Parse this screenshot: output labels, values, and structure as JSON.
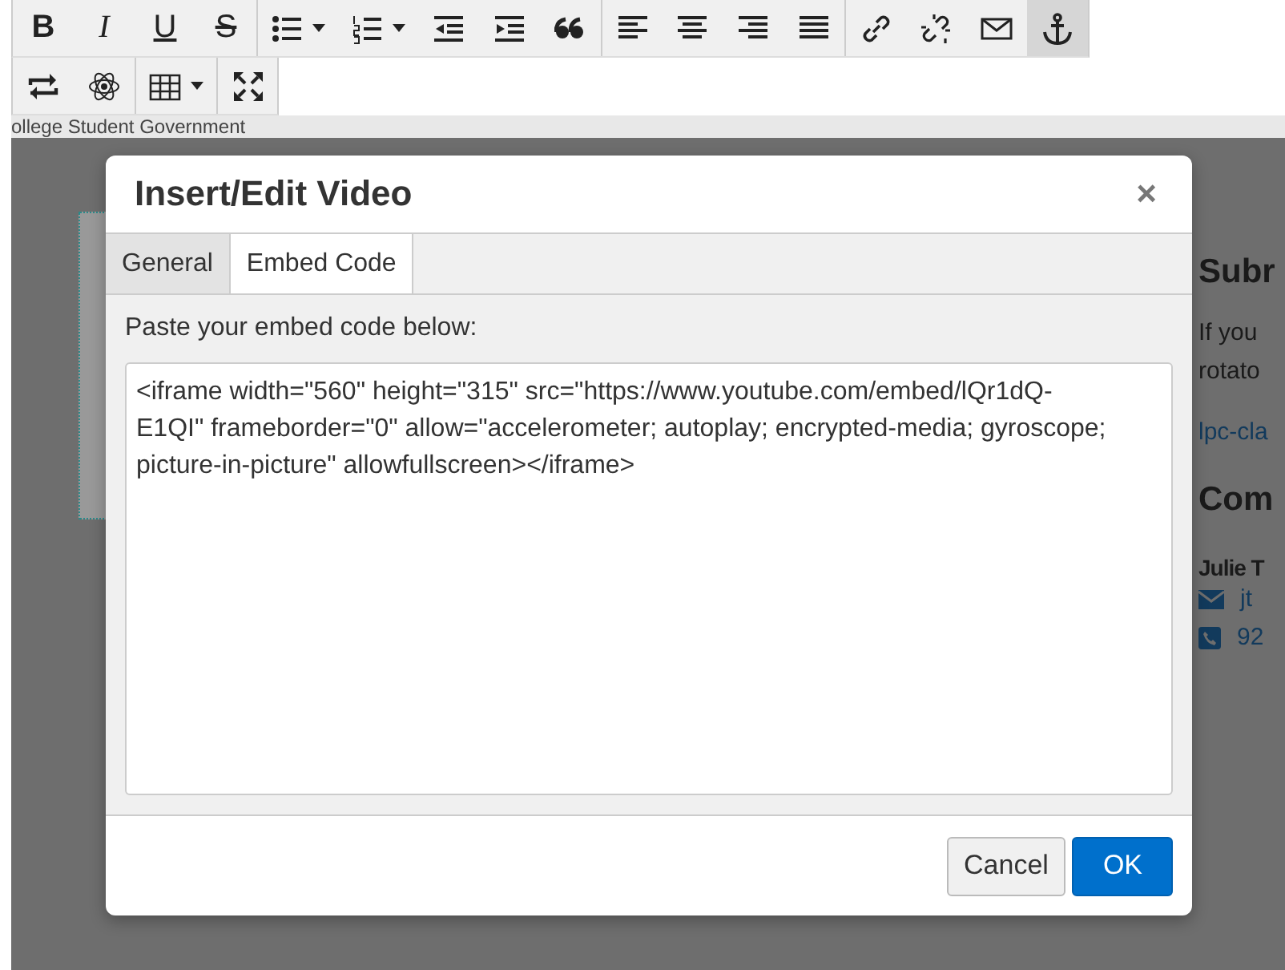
{
  "toolbar": {
    "rows": [
      [
        {
          "kind": "letter",
          "label": "B",
          "active": false
        },
        {
          "kind": "letter",
          "label": "I",
          "active": false
        },
        {
          "kind": "letter",
          "label": "U",
          "active": false
        },
        {
          "kind": "letter",
          "label": "S",
          "active": false
        },
        {
          "kind": "icon",
          "active": false
        },
        {
          "kind": "icon",
          "active": false
        },
        {
          "kind": "icon",
          "active": false
        },
        {
          "kind": "icon",
          "active": false
        },
        {
          "kind": "icon",
          "active": false
        },
        {
          "kind": "icon",
          "active": false
        },
        {
          "kind": "icon",
          "active": false
        },
        {
          "kind": "icon",
          "active": false
        },
        {
          "kind": "icon",
          "active": false
        },
        {
          "kind": "icon",
          "active": false
        },
        {
          "kind": "icon",
          "active": false
        },
        {
          "kind": "icon",
          "active": false
        },
        {
          "kind": "icon",
          "active": true
        }
      ],
      [
        {
          "kind": "icon",
          "active": false
        },
        {
          "kind": "icon",
          "active": false
        },
        {
          "kind": "icon",
          "active": false
        },
        {
          "kind": "icon",
          "active": false
        }
      ]
    ]
  },
  "page": {
    "site_title": "ollege Student Government",
    "side": [
      {
        "kind": "heading",
        "text": "Subr"
      },
      {
        "kind": "para",
        "text": "If you"
      },
      {
        "kind": "para",
        "text": "rotato"
      },
      {
        "kind": "link",
        "text": "lpc-cla"
      },
      {
        "kind": "heading",
        "text": "Com"
      },
      {
        "kind": "name",
        "text": "Julie T"
      },
      {
        "kind": "email",
        "text": "jt"
      },
      {
        "kind": "phone",
        "text": "92"
      }
    ]
  },
  "dialog": {
    "title": "Insert/Edit Video",
    "close": "×",
    "tabs": [
      {
        "label": "General",
        "selected": false
      },
      {
        "label": "Embed Code",
        "selected": true
      }
    ],
    "label": "Paste your embed code below:",
    "value": "<iframe width=\"560\" height=\"315\" src=\"https://www.youtube.com/embed/lQr1dQ-E1QI\" frameborder=\"0\" allow=\"accelerometer; autoplay; encrypted-media; gyroscope; picture-in-picture\" allowfullscreen></iframe>",
    "buttons": [
      {
        "label": "Cancel",
        "kind": "secondary"
      },
      {
        "label": "OK",
        "kind": "primary"
      }
    ]
  }
}
